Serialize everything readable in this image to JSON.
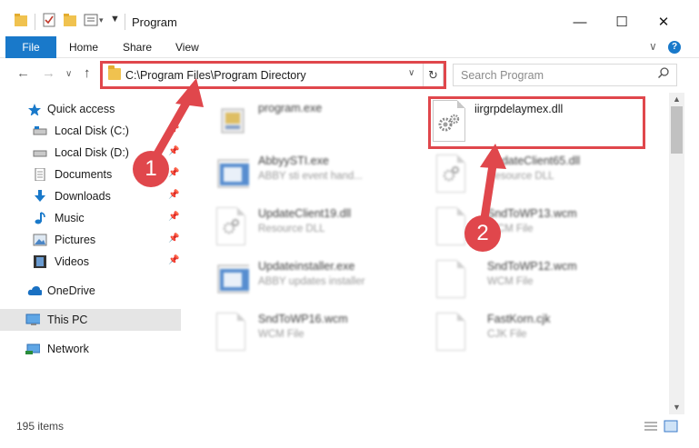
{
  "window": {
    "title": "Program",
    "minimize_glyph": "—",
    "maximize_glyph": "☐",
    "close_glyph": "✕"
  },
  "ribbon": {
    "tabs": [
      "File",
      "Home",
      "Share",
      "View"
    ],
    "expand_glyph": "∨",
    "help_glyph": "?"
  },
  "nav": {
    "back_glyph": "←",
    "forward_glyph": "→",
    "recent_glyph": "∨",
    "up_glyph": "↑",
    "address": "C:\\Program Files\\Program Directory",
    "address_dropdown_glyph": "∨",
    "refresh_glyph": "↻",
    "search_placeholder": "Search Program",
    "search_glyph": "⌕"
  },
  "sidebar": {
    "items": [
      {
        "label": "Quick access",
        "icon": "star-icon",
        "pinned": false
      },
      {
        "label": "Local Disk (C:)",
        "icon": "drive-icon",
        "pinned": true
      },
      {
        "label": "Local Disk (D:)",
        "icon": "drive-icon",
        "pinned": true
      },
      {
        "label": "Documents",
        "icon": "documents-icon",
        "pinned": true
      },
      {
        "label": "Downloads",
        "icon": "download-icon",
        "pinned": true
      },
      {
        "label": "Music",
        "icon": "music-icon",
        "pinned": true
      },
      {
        "label": "Pictures",
        "icon": "pictures-icon",
        "pinned": true
      },
      {
        "label": "Videos",
        "icon": "videos-icon",
        "pinned": true
      },
      {
        "label": "OneDrive",
        "icon": "cloud-icon",
        "pinned": false
      },
      {
        "label": "This PC",
        "icon": "computer-icon",
        "pinned": false,
        "selected": true
      },
      {
        "label": "Network",
        "icon": "network-icon",
        "pinned": false
      }
    ],
    "pin_glyph": "📌"
  },
  "files": [
    {
      "name": "program.exe",
      "desc": "",
      "icon": "program-exe-icon",
      "blurred": true
    },
    {
      "name": "iirgrpdelaymex.dll",
      "desc": "",
      "icon": "dll-gear-icon",
      "blurred": false,
      "highlighted": true
    },
    {
      "name": "AbbyySTI.exe",
      "desc": "ABBY sti event hand...",
      "icon": "app-window-icon",
      "blurred": true
    },
    {
      "name": "UpdateClient65.dll",
      "desc": "Resource DLL",
      "icon": "dll-gear-icon",
      "blurred": true
    },
    {
      "name": "UpdateClient19.dll",
      "desc": "Resource DLL",
      "icon": "dll-gear-icon",
      "blurred": true
    },
    {
      "name": "SndToWP13.wcm",
      "desc": "WCM File",
      "icon": "file-icon",
      "blurred": true
    },
    {
      "name": "Updateinstaller.exe",
      "desc": "ABBY updates installer",
      "icon": "app-window-icon",
      "blurred": true
    },
    {
      "name": "SndToWP12.wcm",
      "desc": "WCM File",
      "icon": "file-icon",
      "blurred": true
    },
    {
      "name": "SndToWP16.wcm",
      "desc": "WCM File",
      "icon": "file-icon",
      "blurred": true
    },
    {
      "name": "FastKorn.cjk",
      "desc": "CJK File",
      "icon": "file-icon",
      "blurred": true
    }
  ],
  "annotations": {
    "step1": "1",
    "step2": "2",
    "color": "#e0474c"
  },
  "status": {
    "item_count": "195 items"
  },
  "colors": {
    "accent": "#1979ca",
    "selection": "#e5e5e5",
    "annotation": "#e0474c"
  }
}
